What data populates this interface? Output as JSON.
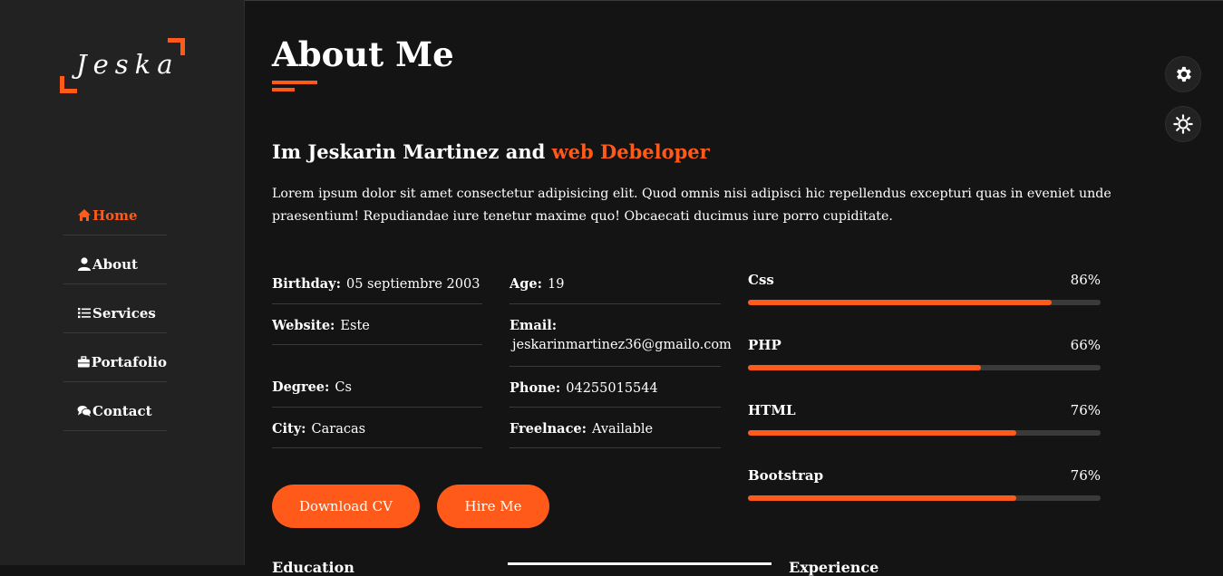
{
  "brand": {
    "logo_text": "Jeska",
    "accent_color": "#ff5a1a"
  },
  "nav": [
    {
      "label": "Home",
      "icon": "home-icon",
      "active": true
    },
    {
      "label": "About",
      "icon": "user-icon",
      "active": false
    },
    {
      "label": "Services",
      "icon": "list-icon",
      "active": false
    },
    {
      "label": "Portafolio",
      "icon": "briefcase-icon",
      "active": false
    },
    {
      "label": "Contact",
      "icon": "comments-icon",
      "active": false
    }
  ],
  "section": {
    "title": "About Me",
    "intro_prefix": "Im Jeskarin Martinez and",
    "intro_accent": "web Debeloper",
    "description": "Lorem ipsum dolor sit amet consectetur adipisicing elit. Quod omnis nisi adipisci hic repellendus excepturi quas in eveniet unde praesentium! Repudiandae iure tenetur maxime quo! Obcaecati ducimus iure porro cupiditate."
  },
  "info_left": [
    {
      "label": "Birthday:",
      "value": "05 septiembre 2003"
    },
    {
      "label": "Website:",
      "value": "Este"
    },
    {
      "label": "Degree:",
      "value": "Cs"
    },
    {
      "label": "City:",
      "value": "Caracas"
    }
  ],
  "info_right": [
    {
      "label": "Age:",
      "value": "19"
    },
    {
      "label": "Email:",
      "value": "jeskarinmartinez36@gmailo.com"
    },
    {
      "label": "Phone:",
      "value": "04255015544"
    },
    {
      "label": "Freelnace:",
      "value": "Available"
    }
  ],
  "skills": [
    {
      "name": "Css",
      "percent_label": "86%",
      "level": 0.86
    },
    {
      "name": "PHP",
      "percent_label": "66%",
      "level": 0.66
    },
    {
      "name": "HTML",
      "percent_label": "76%",
      "level": 0.76
    },
    {
      "name": "Bootstrap",
      "percent_label": "76%",
      "level": 0.76
    }
  ],
  "buttons": {
    "download": "Download CV",
    "hire": "Hire Me"
  },
  "floating": {
    "settings_icon": "gear-icon",
    "theme_icon": "sun-icon"
  },
  "peek": {
    "left": "Education",
    "right": "Experience"
  }
}
